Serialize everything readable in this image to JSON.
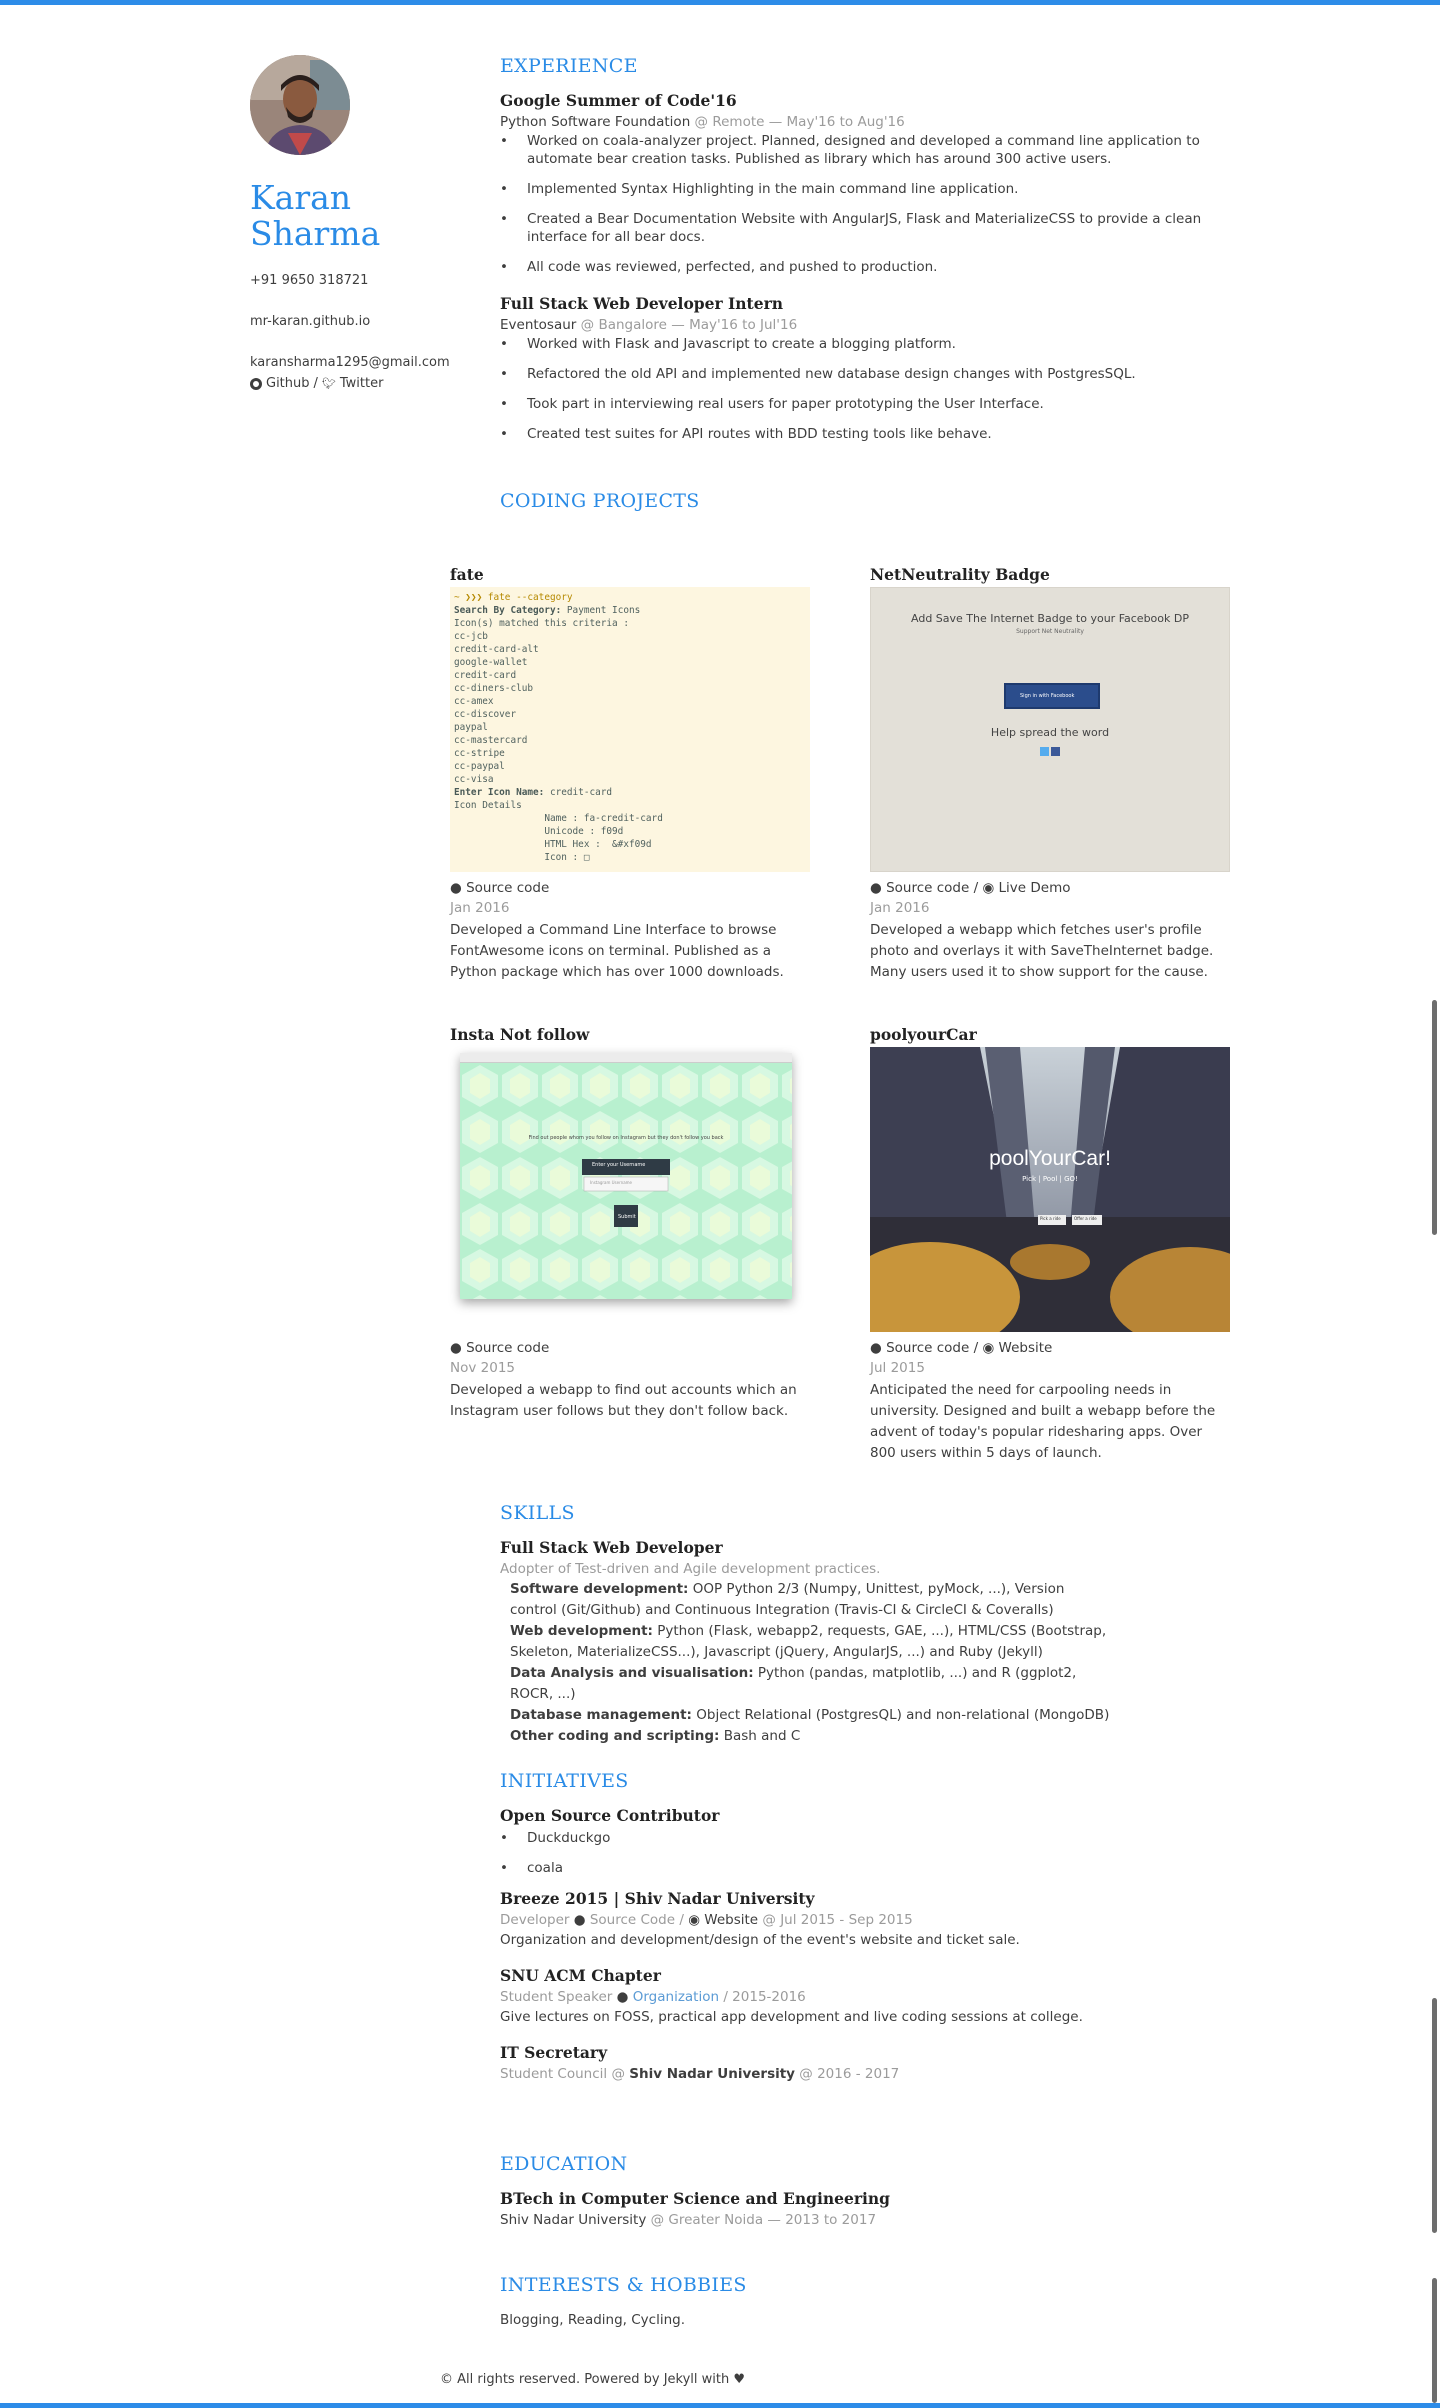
{
  "sidebar": {
    "first_name": "Karan",
    "last_name": "Sharma",
    "phone": "+91 9650 318721",
    "website": "mr-karan.github.io",
    "email": "karansharma1295@gmail.com",
    "github": "Github",
    "separator": "/",
    "twitter": "Twitter"
  },
  "experience": {
    "heading": "EXPERIENCE",
    "jobs": [
      {
        "title": "Google Summer of Code'16",
        "org": "Python Software Foundation",
        "location": "Remote",
        "dates": "May'16 to Aug'16",
        "bullets": [
          "Worked on coala-analyzer project. Planned, designed and developed a command line application to automate bear creation tasks. Published as library which has around 300 active users.",
          "Implemented Syntax Highlighting in the main command line application.",
          "Created a Bear Documentation Website with AngularJS, Flask and MaterializeCSS to provide a clean interface for all bear docs.",
          "All code was reviewed, perfected, and pushed to production."
        ]
      },
      {
        "title": "Full Stack Web Developer Intern",
        "org": "Eventosaur",
        "location": "Bangalore",
        "dates": "May'16 to Jul'16",
        "bullets": [
          "Worked with Flask and Javascript to create a blogging platform.",
          "Refactored the old API and implemented new database design changes with PostgresSQL.",
          "Took part in interviewing real users for paper prototyping the User Interface.",
          "Created test suites for API routes with BDD testing tools like behave."
        ]
      }
    ]
  },
  "projects": {
    "heading": "CODING PROJECTS",
    "items": [
      {
        "title": "fate",
        "links": [
          "Source code"
        ],
        "date": "Jan 2016",
        "desc": "Developed a Command Line Interface to browse FontAwesome icons on terminal. Published as a Python package which has over 1000 downloads."
      },
      {
        "title": "NetNeutrality Badge",
        "links": [
          "Source code",
          "Live Demo"
        ],
        "date": "Jan 2016",
        "desc": "Developed a webapp which fetches user's profile photo and overlays it with SaveTheInternet badge. Many users used it to show support for the cause."
      },
      {
        "title": "Insta Not follow",
        "links": [
          "Source code"
        ],
        "date": "Nov 2015",
        "desc": "Developed a webapp to find out accounts which an Instagram user follows but they don't follow back."
      },
      {
        "title": "poolyourCar",
        "links": [
          "Source code",
          "Website"
        ],
        "date": "Jul 2015",
        "desc": "Anticipated the need for carpooling needs in university. Designed and built a webapp before the advent of today's popular ridesharing apps. Over 800 users within 5 days of launch."
      }
    ],
    "fate_terminal": {
      "prompt": "~ ❯❯❯ ",
      "command": "fate --category",
      "search_label": "Search By Category:",
      "search_value": "Payment Icons",
      "matched": "Icon(s) matched this criteria :",
      "icons": [
        "cc-jcb",
        "credit-card-alt",
        "google-wallet",
        "credit-card",
        "cc-diners-club",
        "cc-amex",
        "cc-discover",
        "paypal",
        "cc-mastercard",
        "cc-stripe",
        "cc-paypal",
        "cc-visa"
      ],
      "enter_label": "Enter Icon Name:",
      "enter_value": "credit-card",
      "details_label": "Icon Details",
      "details": [
        "Name : fa-credit-card",
        "Unicode : f09d",
        "HTML Hex :  &#xf09d",
        "Icon : □"
      ]
    },
    "badge_shot": {
      "heading": "Add Save The Internet Badge to your Facebook DP",
      "sub": "Support Net Neutrality",
      "button": "Sign in with Facebook",
      "spread": "Help spread the word"
    },
    "insta_shot": {
      "prompt": "Find out people whom you follow on Instagram but they don't follow you back",
      "tab_label": "Enter your",
      "tab_value": "Username",
      "input_placeholder": "Instagram Username",
      "submit": "Submit"
    },
    "pool_shot": {
      "title": "poolYourCar!",
      "sub": "Pick | Pool | GO!",
      "btn1": "Pick a ride",
      "btn2": "Offer a ride"
    }
  },
  "skills": {
    "heading": "SKILLS",
    "title": "Full Stack Web Developer",
    "subtitle": "Adopter of Test-driven and Agile development practices.",
    "lines": [
      {
        "label": "Software development:",
        "text": " OOP Python 2/3 (Numpy, Unittest, pyMock, ...), Version control (Git/Github) and Continuous Integration (Travis-CI & CircleCI & Coveralls)"
      },
      {
        "label": "Web development:",
        "text": " Python (Flask, webapp2, requests, GAE, ...), HTML/CSS (Bootstrap, Skeleton, MaterializeCSS...), Javascript (jQuery, AngularJS, ...) and Ruby (Jekyll)"
      },
      {
        "label": "Data Analysis and visualisation:",
        "text": " Python (pandas, matplotlib, ...) and R (ggplot2, ROCR, ...)"
      },
      {
        "label": "Database management:",
        "text": " Object Relational (PostgresQL) and non-relational (MongoDB)"
      },
      {
        "label": "Other coding and scripting:",
        "text": " Bash and C"
      }
    ]
  },
  "initiatives": {
    "heading": "INITIATIVES",
    "open_source": {
      "title": "Open Source Contributor",
      "items": [
        "Duckduckgo",
        "coala"
      ]
    },
    "breeze": {
      "title": "Breeze 2015 | Shiv Nadar University",
      "role": "Developer",
      "source": "Source Code",
      "sep": "/",
      "website": "Website",
      "dates": "Jul 2015 - Sep 2015",
      "desc": "Organization and development/design of the event's website and ticket sale."
    },
    "acm": {
      "title": "SNU ACM Chapter",
      "role": "Student Speaker",
      "org": "Organization",
      "dates": "/ 2015-2016",
      "desc": "Give lectures on FOSS, practical app development and live coding sessions at college."
    },
    "it": {
      "title": "IT Secretary",
      "role": "Student Council",
      "org": "Shiv Nadar University",
      "dates": "2016 - 2017"
    }
  },
  "education": {
    "heading": "EDUCATION",
    "degree": "BTech in Computer Science and Engineering",
    "school": "Shiv Nadar University",
    "location": "Greater Noida",
    "dates": "2013 to 2017"
  },
  "interests": {
    "heading": "INTERESTS & HOBBIES",
    "text": "Blogging, Reading, Cycling."
  },
  "footer": {
    "text": "© All rights reserved. Powered by Jekyll with ♥"
  },
  "colors": {
    "accent": "#2a8be6",
    "muted": "#9b9b9b",
    "text": "#3e3e3e"
  }
}
